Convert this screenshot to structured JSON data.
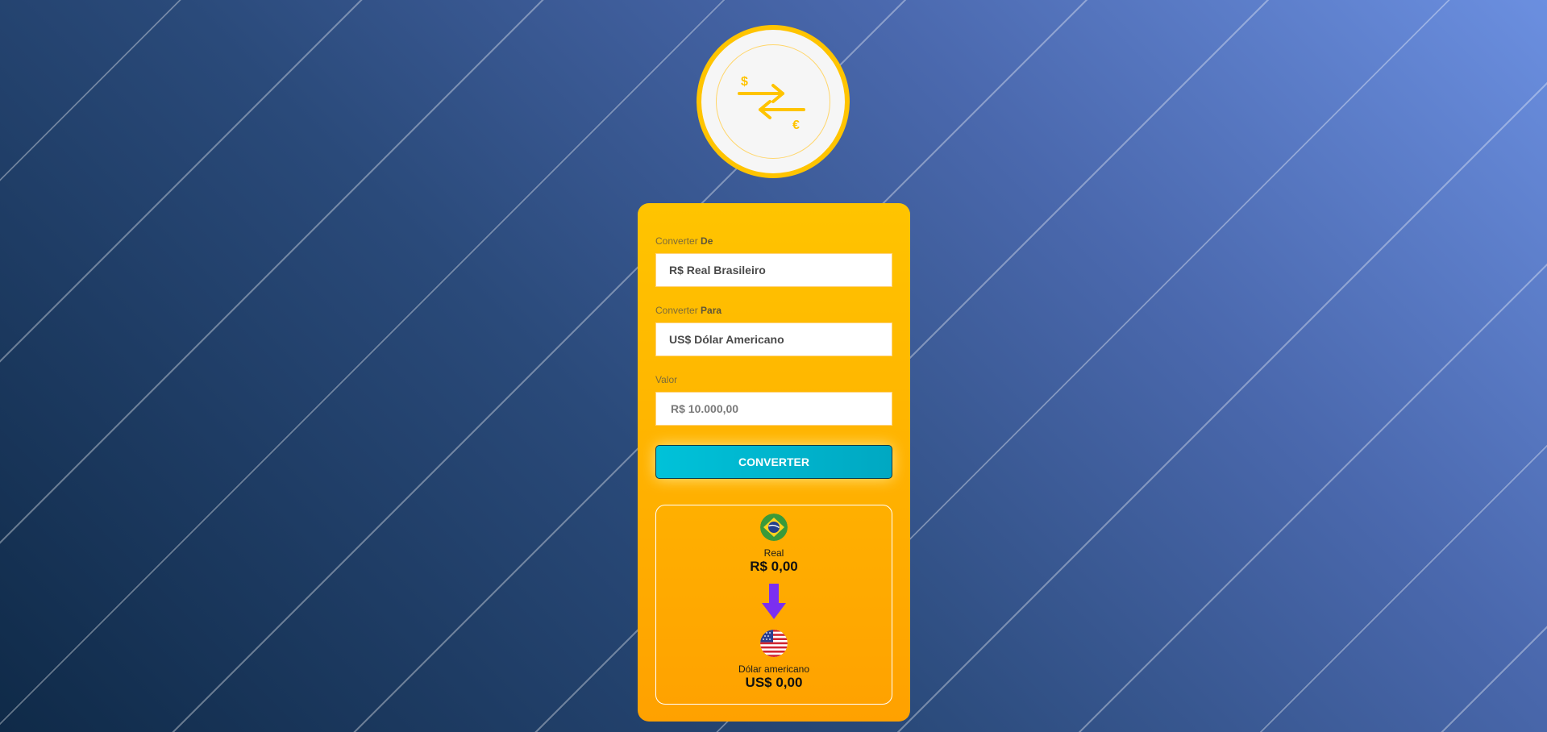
{
  "from_field": {
    "label_prefix": "Converter",
    "label_strong": "De",
    "value": "R$ Real Brasileiro"
  },
  "to_field": {
    "label_prefix": "Converter",
    "label_strong": "Para",
    "value": "US$ Dólar Americano"
  },
  "amount_field": {
    "label": "Valor",
    "placeholder": "R$ 10.000,00"
  },
  "convert_button": {
    "label": "CONVERTER"
  },
  "result": {
    "from_currency": {
      "name": "Real",
      "value": "R$ 0,00",
      "flag_icon": "brazil-flag-icon"
    },
    "to_currency": {
      "name": "Dólar americano",
      "value": "US$ 0,00",
      "flag_icon": "us-flag-icon"
    }
  },
  "logo": {
    "currency_symbol_top": "$",
    "currency_symbol_bottom": "€",
    "icon": "currency-exchange-icon"
  },
  "colors": {
    "card_top": "#ffc400",
    "card_bottom": "#ffa100",
    "button": "#00b8cf",
    "arrow": "#7b2ff0"
  }
}
